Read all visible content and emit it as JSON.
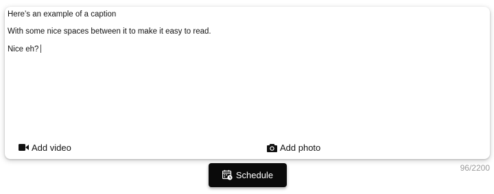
{
  "caption": {
    "lines": [
      "Here’s an example of a caption",
      "With some nice spaces between it to make it easy to read.",
      "Nice eh?"
    ]
  },
  "media": {
    "add_video_label": "Add video",
    "add_video_icon": "video-camera-icon",
    "add_photo_label": "Add photo",
    "add_photo_icon": "camera-icon"
  },
  "counter": {
    "text": "96/2200"
  },
  "schedule": {
    "label": "Schedule",
    "icon": "calendar-clock-icon"
  }
}
